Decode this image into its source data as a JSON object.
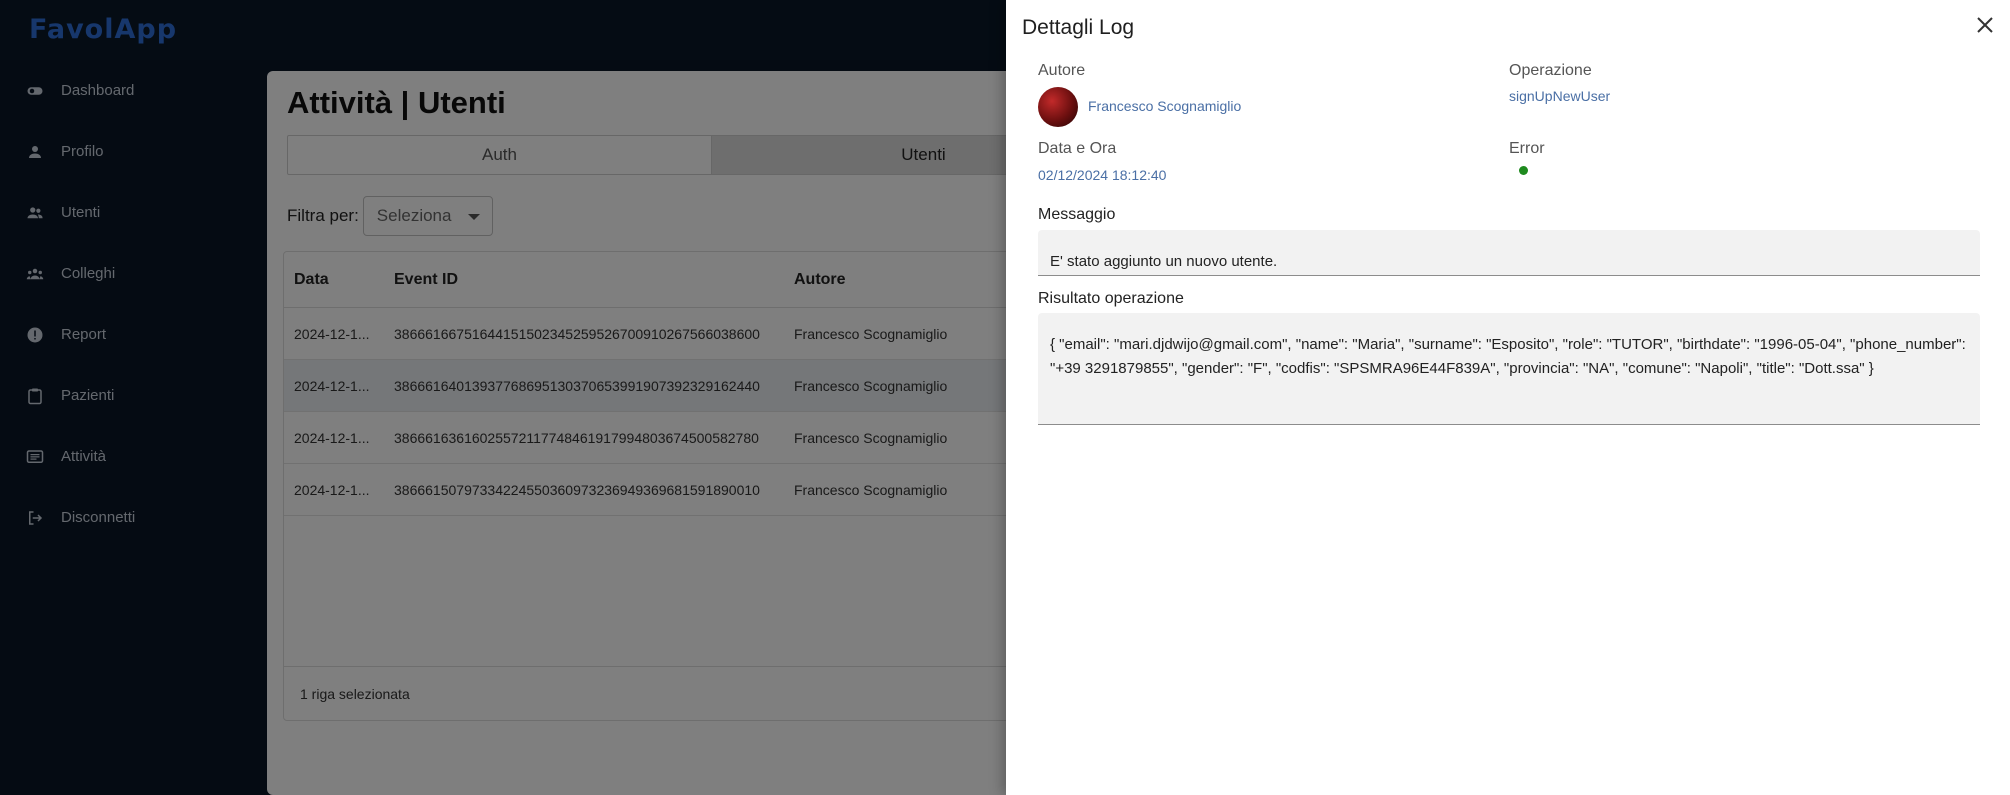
{
  "app": {
    "logo": "FavolApp"
  },
  "sidebar": {
    "items": [
      {
        "label": "Dashboard",
        "icon": "toggle-icon"
      },
      {
        "label": "Profilo",
        "icon": "person-icon"
      },
      {
        "label": "Utenti",
        "icon": "people-icon"
      },
      {
        "label": "Colleghi",
        "icon": "groups-icon"
      },
      {
        "label": "Report",
        "icon": "report-icon"
      },
      {
        "label": "Pazienti",
        "icon": "clipboard-icon"
      },
      {
        "label": "Attività",
        "icon": "list-icon"
      },
      {
        "label": "Disconnetti",
        "icon": "logout-icon"
      }
    ]
  },
  "main": {
    "title": "Attività | Utenti",
    "tabs": [
      "Auth",
      "Utenti"
    ],
    "active_tab": "Utenti",
    "filter": {
      "label": "Filtra per:",
      "placeholder": "Seleziona"
    },
    "table": {
      "columns": [
        "Data",
        "Event ID",
        "Autore"
      ],
      "rows": [
        {
          "data": "2024-12-1...",
          "event_id": "38666166751644151502345259526700910267566038600",
          "autore": "Francesco Scognamiglio"
        },
        {
          "data": "2024-12-1...",
          "event_id": "38666164013937768695130370653991907392329162440",
          "autore": "Francesco Scognamiglio"
        },
        {
          "data": "2024-12-1...",
          "event_id": "38666163616025572117748461917994803674500582780",
          "autore": "Francesco Scognamiglio"
        },
        {
          "data": "2024-12-1...",
          "event_id": "38666150797334224550360973236949369681591890010",
          "autore": "Francesco Scognamiglio"
        }
      ],
      "selected_index": 1,
      "footer": "1 riga selezionata"
    }
  },
  "drawer": {
    "title": "Dettagli Log",
    "autore_label": "Autore",
    "autore_value": "Francesco Scognamiglio",
    "operazione_label": "Operazione",
    "operazione_value": "signUpNewUser",
    "data_label": "Data e Ora",
    "data_value": "02/12/2024 18:12:40",
    "error_label": "Error",
    "error_status_color": "#1e8a1e",
    "messaggio_label": "Messaggio",
    "messaggio_value": "E' stato aggiunto un nuovo utente.",
    "risultato_label": "Risultato operazione",
    "risultato_value": "{ \"email\": \"mari.djdwijo@gmail.com\", \"name\": \"Maria\", \"surname\": \"Esposito\", \"role\": \"TUTOR\", \"birthdate\": \"1996-05-04\", \"phone_number\": \"+39 3291879855\", \"gender\": \"F\", \"codfis\": \"SPSMRA96E44F839A\", \"provincia\": \"NA\", \"comune\": \"Napoli\", \"title\": \"Dott.ssa\" }"
  }
}
